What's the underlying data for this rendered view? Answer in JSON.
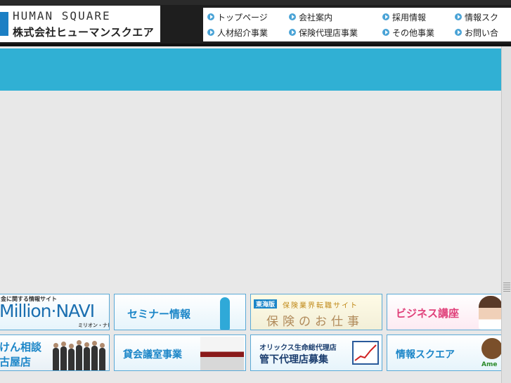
{
  "header": {
    "logo_en": "HUMAN SQUARE",
    "logo_ja": "株式会社ヒューマンスクエア"
  },
  "nav": {
    "row1": [
      "トップページ",
      "会社案内",
      "採用情報",
      "情報スク"
    ],
    "row2": [
      "人材紹介事業",
      "保険代理店事業",
      "その他事業",
      "お問い合"
    ]
  },
  "banners": {
    "million_top": "金に関する情報サイト",
    "million_main": "Million·NAVI",
    "million_sub": "ミリオン・ナビ",
    "seminar": "セミナー情報",
    "hoken_badge": "東海版",
    "hoken_top": "保険業界転職サイト",
    "hoken_main": "保険のお仕事",
    "business": "ビジネス講座",
    "soudan_1": "けん相談",
    "soudan_2": "古屋店",
    "kashi": "貸会議室事業",
    "orix_1": "オリックス生命総代理店",
    "orix_2": "管下代理店募集",
    "joho": "情報スクエア",
    "ameba": "Ame"
  },
  "colors": {
    "accent": "#30b0d4",
    "banner_text": "#1c86c8",
    "topbar": "#1e1e1e"
  }
}
